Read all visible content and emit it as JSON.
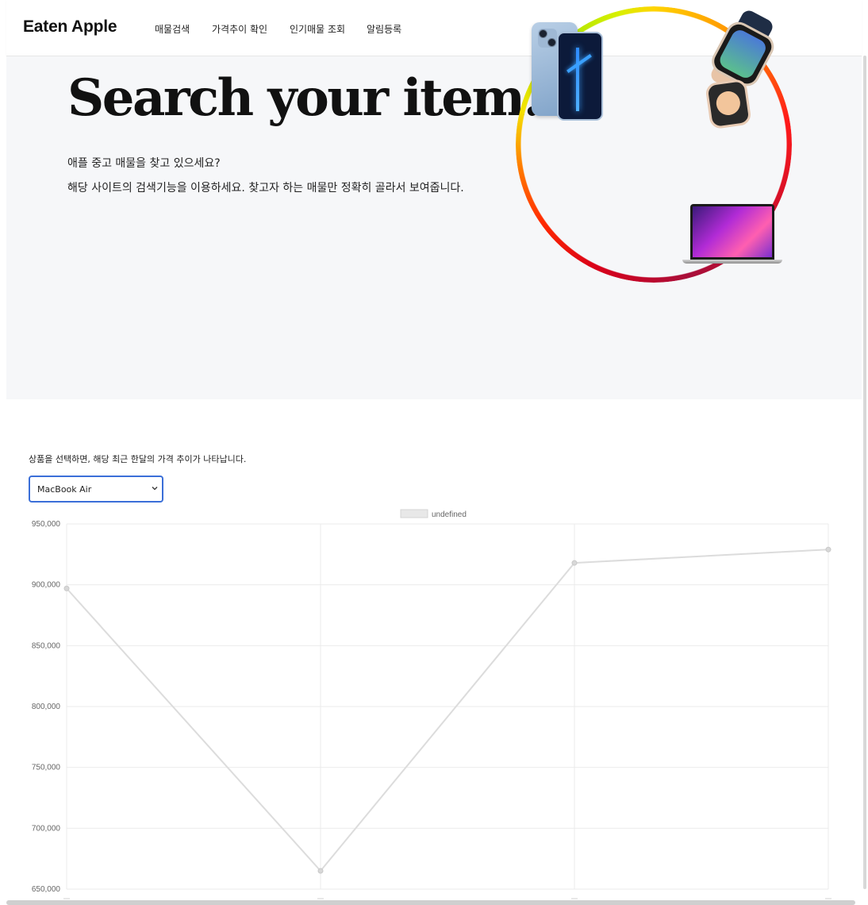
{
  "nav": {
    "brand": "Eaten Apple",
    "items": [
      {
        "label": "매물검색"
      },
      {
        "label": "가격추이 확인"
      },
      {
        "label": "인기매물 조회"
      },
      {
        "label": "알림등록"
      }
    ]
  },
  "hero": {
    "title": "Search your item.",
    "line1": "애플 중고 매물을 찾고 있으세요?",
    "line2": "해당 사이트의 검색기능을 이용하세요. 찾고자 하는 매물만 정확히 골라서 보여줍니다."
  },
  "price_trend": {
    "caption": "상품을 선택하면, 해당 최근 한달의 가격 추이가 나타납니다.",
    "selected_product": "MacBook Air"
  },
  "colors": {
    "select_border": "#3b6fd8",
    "series": "#dcdcdc",
    "hero_bg": "#f6f7f9"
  },
  "chart_data": {
    "type": "line",
    "legend": [
      "undefined"
    ],
    "series": [
      {
        "name": "undefined",
        "values": [
          897000,
          665000,
          918000,
          929000
        ]
      }
    ],
    "x_categories_count": 4,
    "y_ticks": [
      "950,000",
      "900,000",
      "850,000",
      "800,000",
      "750,000",
      "700,000",
      "650,000"
    ],
    "ylim": [
      650000,
      950000
    ],
    "grid": true,
    "legend_position": "top-center"
  }
}
